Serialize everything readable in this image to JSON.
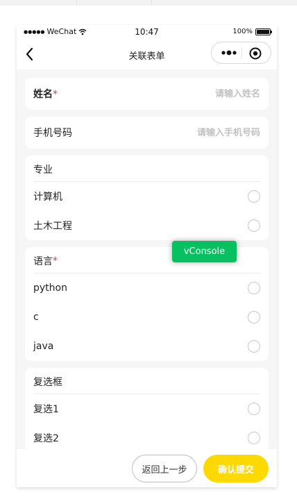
{
  "status_bar": {
    "carrier": "WeChat",
    "time": "10:47",
    "battery": "100%"
  },
  "nav": {
    "title": "关联表单"
  },
  "form": {
    "name": {
      "label": "姓名",
      "required_mark": "*",
      "placeholder": "请输入姓名"
    },
    "phone": {
      "label": "手机号码",
      "placeholder": "请输入手机号码"
    },
    "major": {
      "title": "专业",
      "options": [
        "计算机",
        "土木工程"
      ]
    },
    "language": {
      "title": "语言",
      "required_mark": "*",
      "options": [
        "python",
        "c",
        "java"
      ]
    },
    "checkbox": {
      "title": "复选框",
      "options": [
        "复选1",
        "复选2"
      ]
    }
  },
  "vconsole": {
    "label": "vConsole"
  },
  "footer": {
    "back_label": "返回上一步",
    "submit_label": "确认提交"
  },
  "colors": {
    "accent": "#fdd902",
    "vconsole": "#07c160",
    "required": "#e53935"
  }
}
